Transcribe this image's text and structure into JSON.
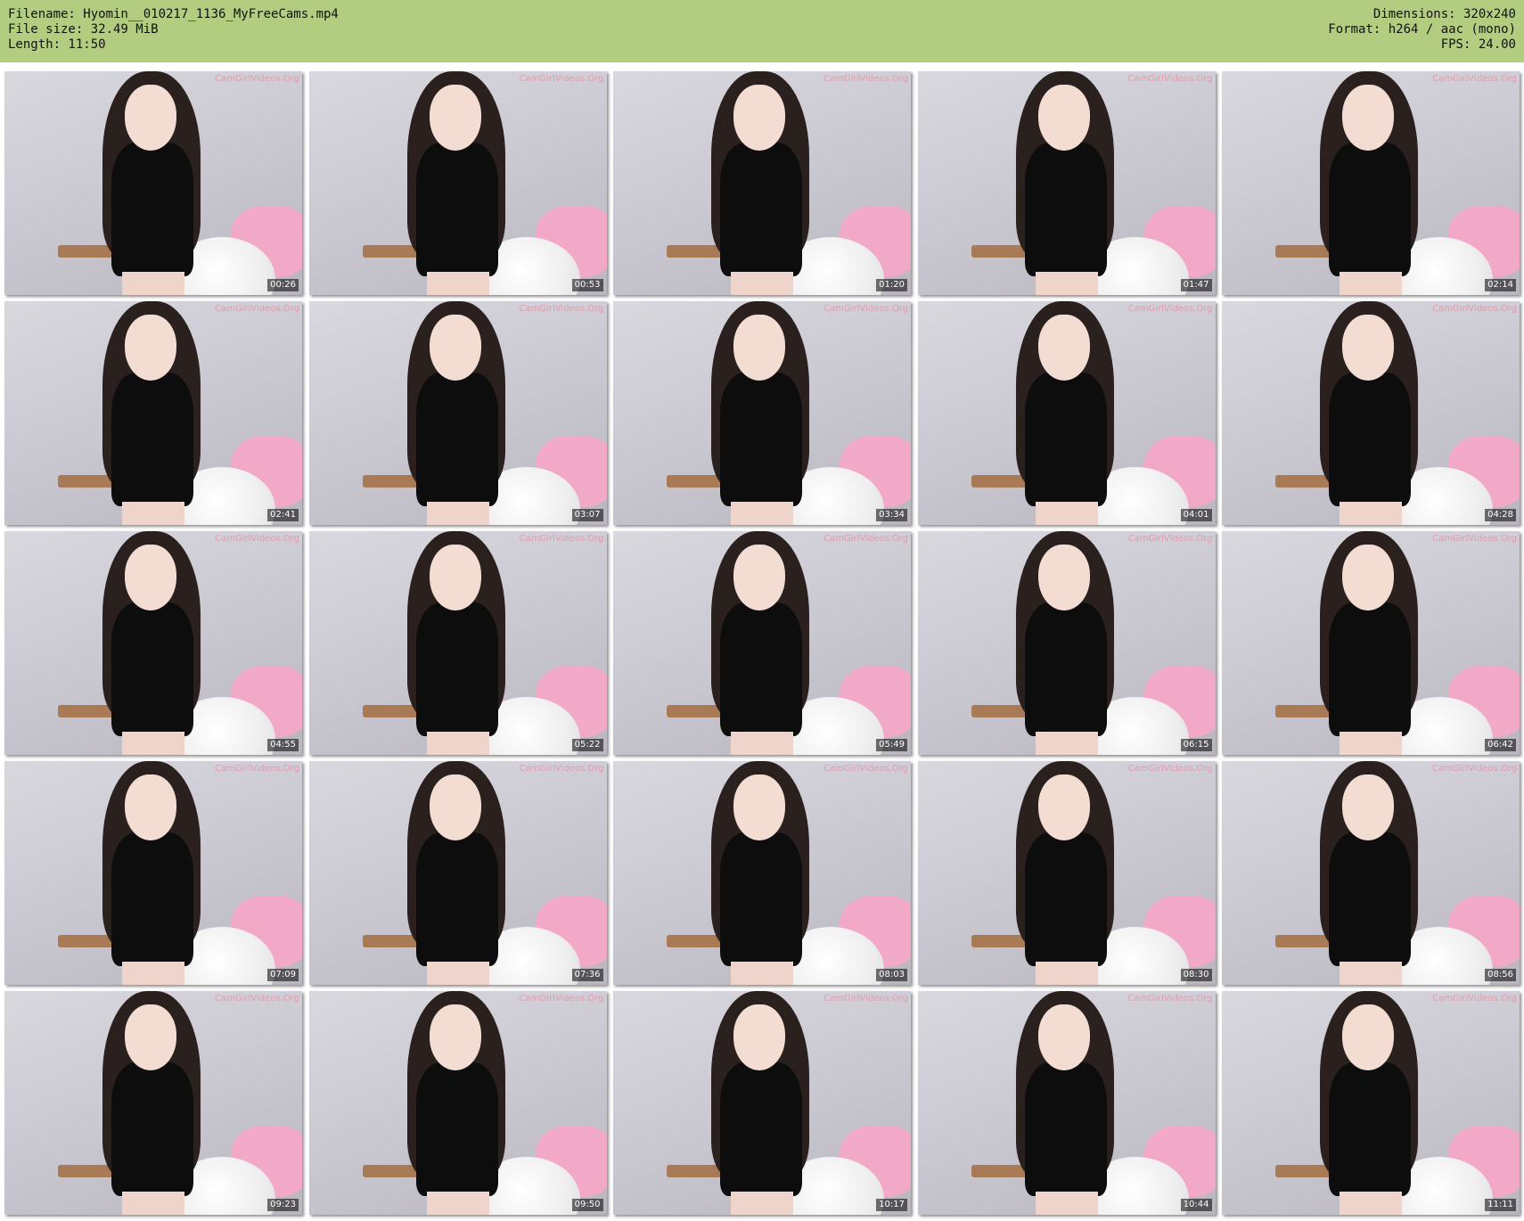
{
  "header": {
    "filename": "Filename: Hyomin__010217_1136_MyFreeCams.mp4",
    "filesize": "File size: 32.49 MiB",
    "length": "Length: 11:50",
    "dimensions": "Dimensions: 320x240",
    "format": "Format: h264 / aac (mono)",
    "fps": "FPS: 24.00",
    "background_color": "#b2cd80"
  },
  "watermark": "CamGirlVideos.Org",
  "thumbnails": [
    {
      "timestamp": "00:26"
    },
    {
      "timestamp": "00:53"
    },
    {
      "timestamp": "01:20"
    },
    {
      "timestamp": "01:47"
    },
    {
      "timestamp": "02:14"
    },
    {
      "timestamp": "02:41"
    },
    {
      "timestamp": "03:07"
    },
    {
      "timestamp": "03:34"
    },
    {
      "timestamp": "04:01"
    },
    {
      "timestamp": "04:28"
    },
    {
      "timestamp": "04:55"
    },
    {
      "timestamp": "05:22"
    },
    {
      "timestamp": "05:49"
    },
    {
      "timestamp": "06:15"
    },
    {
      "timestamp": "06:42"
    },
    {
      "timestamp": "07:09"
    },
    {
      "timestamp": "07:36"
    },
    {
      "timestamp": "08:03"
    },
    {
      "timestamp": "08:30"
    },
    {
      "timestamp": "08:56"
    },
    {
      "timestamp": "09:23"
    },
    {
      "timestamp": "09:50"
    },
    {
      "timestamp": "10:17"
    },
    {
      "timestamp": "10:44"
    },
    {
      "timestamp": "11:11"
    }
  ]
}
